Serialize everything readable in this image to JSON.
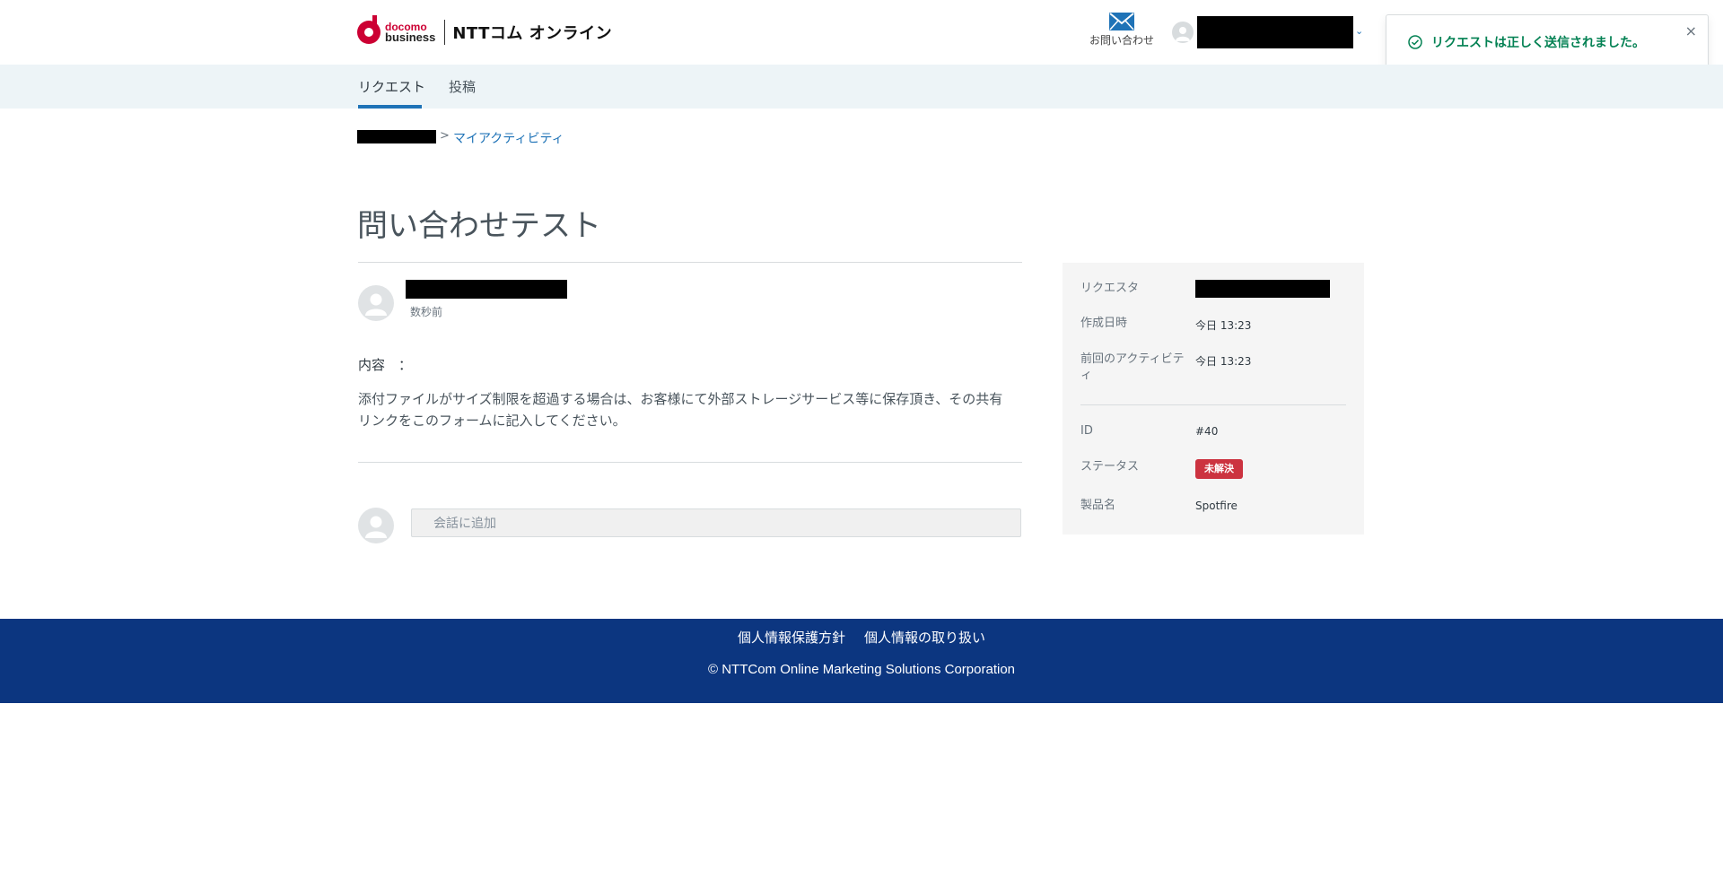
{
  "header": {
    "logo_docomo": "docomo",
    "logo_business": "business",
    "logo_brand": "NTTコム オンライン",
    "contact_label": "お問い合わせ",
    "user_chevron": "⌄"
  },
  "toast": {
    "message": "リクエストは正しく送信されました。",
    "close": "×"
  },
  "subnav": {
    "tabs": [
      {
        "label": "リクエスト",
        "active": true
      },
      {
        "label": "投稿",
        "active": false
      }
    ]
  },
  "breadcrumb": {
    "separator": ">",
    "current": "マイアクティビティ"
  },
  "request": {
    "title": "問い合わせテスト",
    "time_ago": "数秒前",
    "content_label": "内容　：",
    "content_body": "添付ファイルがサイズ制限を超過する場合は、お客様にて外部ストレージサービス等に保存頂き、その共有リンクをこのフォームに記入してください。"
  },
  "comment": {
    "placeholder": "会話に追加"
  },
  "sidebar": {
    "requester_label": "リクエスタ",
    "created_label": "作成日時",
    "created_value": "今日 13:23",
    "last_activity_label": "前回のアクティビティ",
    "last_activity_value": "今日 13:23",
    "id_label": "ID",
    "id_value": "#40",
    "status_label": "ステータス",
    "status_value": "未解決",
    "product_label": "製品名",
    "product_value": "Spotfire"
  },
  "colors": {
    "accent": "#1f73b7",
    "success": "#038153",
    "status_open": "#cc3340",
    "footer_bg": "#0c3680",
    "brand_red": "#cc0033"
  },
  "footer": {
    "privacy_policy": "個人情報保護方針",
    "privacy_handling": "個人情報の取り扱い",
    "copyright": "© NTTCom Online Marketing Solutions Corporation"
  }
}
